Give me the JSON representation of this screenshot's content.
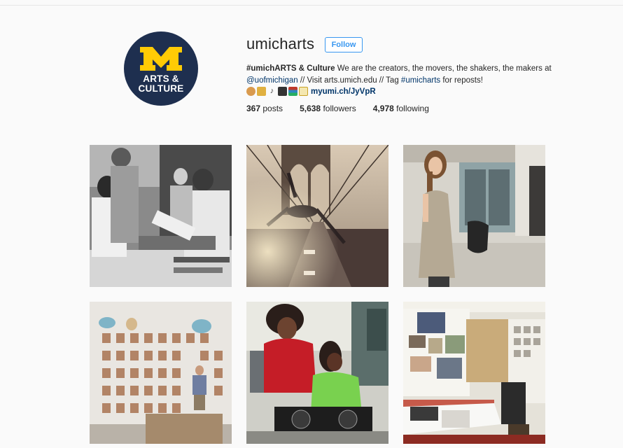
{
  "profile": {
    "avatar_text_line1": "ARTS &",
    "avatar_text_line2": "CULTURE",
    "avatar_letter": "M",
    "username": "umicharts",
    "follow_label": "Follow",
    "bio": {
      "bold_title": "#umichARTS & Culture",
      "text1": " We are the creators, the movers, the shakers, the makers at ",
      "mention": "@uofmichigan",
      "text2": " // Visit arts.umich.edu // Tag ",
      "hashtag": "#umicharts",
      "text3": " for reposts!",
      "url": "myumi.ch/JyVpR"
    },
    "stats": {
      "posts_count": "367",
      "posts_label": "posts",
      "followers_count": "5,638",
      "followers_label": "followers",
      "following_count": "4,978",
      "following_label": "following"
    }
  },
  "colors": {
    "brand_navy": "#1e2f4f",
    "brand_maize": "#ffcb05",
    "follow_blue": "#3897f0",
    "link_blue": "#003569"
  },
  "emojis": [
    "palette-emoji",
    "saxophone-emoji",
    "music-notes-emoji",
    "clapperboard-emoji",
    "books-emoji",
    "memo-emoji"
  ],
  "posts": [
    {
      "subject": "woodcarving-photo"
    },
    {
      "subject": "bridge-dancer-photo"
    },
    {
      "subject": "girl-portrait-photo"
    },
    {
      "subject": "ceramics-wall-photo"
    },
    {
      "subject": "dj-girls-photo"
    },
    {
      "subject": "art-studio-photo"
    }
  ]
}
